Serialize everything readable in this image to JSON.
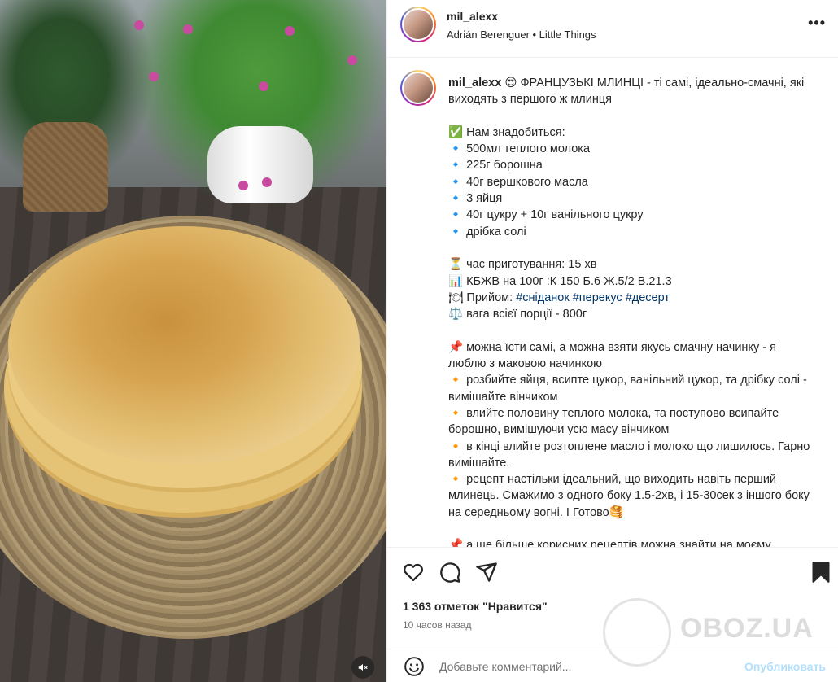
{
  "post": {
    "username": "mil_alexx",
    "audio": "Adrián Berenguer • Little Things"
  },
  "caption": {
    "username": "mil_alexx",
    "lines": [
      {
        "text": "😍 ФРАНЦУЗЬКІ МЛИНЦІ - ті самі, ідеально-смачні, які виходять з першого ж млинця"
      },
      {
        "text": ""
      },
      {
        "text": "✅ Нам знадобиться:"
      },
      {
        "text": "🔹 500мл теплого молока"
      },
      {
        "text": "🔹 225г борошна"
      },
      {
        "text": "🔹 40г вершкового масла"
      },
      {
        "text": "🔹 3 яйця"
      },
      {
        "text": "🔹 40г цукру + 10г ванільного цукру"
      },
      {
        "text": "🔹 дрібка солі"
      },
      {
        "text": ""
      },
      {
        "text": "⏳ час приготування: 15 хв"
      },
      {
        "text": "📊 КБЖВ на 100г :К 150 Б.6 Ж.5/2 В.21.3"
      },
      {
        "text": "🍽 Прийом: "
      },
      {
        "text": "⚖️ вага всієї порції - 800г"
      },
      {
        "text": ""
      },
      {
        "text": "📌 можна їсти самі, а можна взяти якусь смачну начинку - я люблю з маковою начинкою"
      },
      {
        "text": "🔸 розбийте яйця, всипте цукор, ванільний цукор, та дрібку солі - вимішайте вінчиком"
      },
      {
        "text": "🔸 влийте половину теплого молока, та поступово всипайте борошно, вимішуючи усю масу вінчиком"
      },
      {
        "text": "🔸 в кінці влийте розтоплене масло і молоко що лишилось. Гарно вимішайте."
      },
      {
        "text": "🔸 рецепт настільки ідеальний, що виходить навіть перший млинець. Смажимо з одного боку 1.5-2хв, і 15-30сек з іншого боку на середньому вогні. І Готово🥞"
      },
      {
        "text": ""
      },
      {
        "text": "📌 а ще більше корисних рецептів можна знайти на моєму"
      }
    ],
    "hashtags": "#сніданок #перекус #десерт"
  },
  "actions": {
    "like_icon": "heart-icon",
    "comment_icon": "comment-icon",
    "share_icon": "share-icon",
    "save_icon": "bookmark-icon",
    "likes_text": "1 363 отметок \"Нравится\"",
    "time_ago": "10 часов назад",
    "watermark": "OBOZ.UA"
  },
  "comment": {
    "placeholder": "Добавьте комментарий...",
    "post_label": "Опубликовать"
  },
  "colors": {
    "link": "#00376b",
    "post_button_disabled": "#b2dffc"
  }
}
